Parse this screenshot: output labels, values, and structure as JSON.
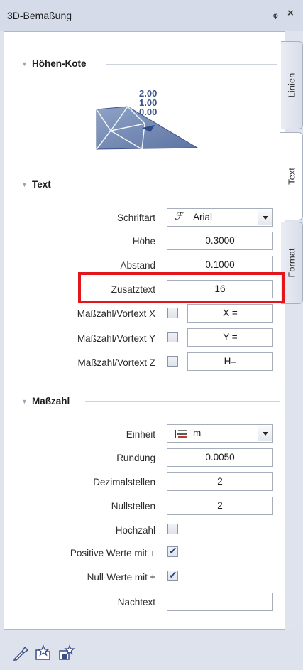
{
  "window": {
    "title": "3D-Bemaßung",
    "pin_glyph": "ᵩ",
    "close_glyph": "×"
  },
  "tabs": [
    {
      "label": "Linien",
      "active": false
    },
    {
      "label": "Text",
      "active": true
    },
    {
      "label": "Format",
      "active": false
    }
  ],
  "hoehen_kote": {
    "title": "Höhen-Kote",
    "preview_values": [
      "2.00",
      "1.00",
      "0.00"
    ]
  },
  "text_section": {
    "title": "Text",
    "schriftart": {
      "label": "Schriftart",
      "value": "Arial",
      "icon": "font-icon"
    },
    "hoehe": {
      "label": "Höhe",
      "value": "0.3000"
    },
    "abstand": {
      "label": "Abstand",
      "value": "0.1000"
    },
    "zusatztext": {
      "label": "Zusatztext",
      "value": "16"
    },
    "vortext_x": {
      "label": "Maßzahl/Vortext X",
      "checked": false,
      "value": "X ="
    },
    "vortext_y": {
      "label": "Maßzahl/Vortext Y",
      "checked": false,
      "value": "Y ="
    },
    "vortext_z": {
      "label": "Maßzahl/Vortext Z",
      "checked": false,
      "value": "H="
    }
  },
  "masszahl_section": {
    "title": "Maßzahl",
    "einheit": {
      "label": "Einheit",
      "value": "m",
      "icon": "unit-icon"
    },
    "rundung": {
      "label": "Rundung",
      "value": "0.0050"
    },
    "dezimalstellen": {
      "label": "Dezimalstellen",
      "value": "2"
    },
    "nullstellen": {
      "label": "Nullstellen",
      "value": "2"
    },
    "hochzahl": {
      "label": "Hochzahl",
      "checked": false
    },
    "positive": {
      "label": "Positive Werte mit +",
      "checked": true
    },
    "nullwerte": {
      "label": "Null-Werte mit ±",
      "checked": true
    },
    "nachtext": {
      "label": "Nachtext",
      "value": ""
    }
  },
  "footer": {
    "icons": [
      "eyedropper-icon",
      "open-favorite-icon",
      "save-favorite-icon"
    ]
  },
  "colors": {
    "highlight": "#e3161b",
    "accent_blue": "#1f3f7a"
  }
}
